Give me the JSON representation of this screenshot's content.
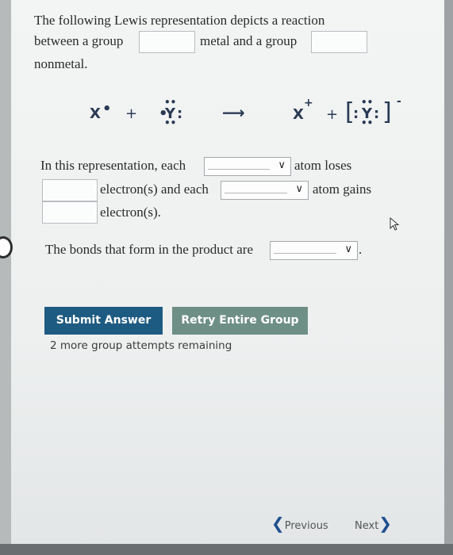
{
  "question": {
    "line1": "The following Lewis representation depicts a reaction",
    "line2_a": "between a group",
    "line2_b": "metal and a group",
    "line3": "nonmetal."
  },
  "equation": {
    "reactant1": "X",
    "plus1": "+",
    "reactant2": "Y",
    "arrow": "⟶",
    "product1": "X",
    "product1_charge": "+",
    "plus2": "+",
    "product2": "Y",
    "product2_charge": "-"
  },
  "representation": {
    "text_a": "In this representation, each",
    "text_b": "atom loses",
    "text_c": "electron(s) and each",
    "text_d": "atom gains",
    "text_e": "electron(s)."
  },
  "bonds": {
    "text": "The bonds that form in the product are",
    "period": "."
  },
  "buttons": {
    "submit": "Submit Answer",
    "retry": "Retry Entire Group"
  },
  "attempts": "2 more group attempts remaining",
  "nav": {
    "previous": "Previous",
    "next": "Next"
  },
  "colors": {
    "submit_bg": "#1e5b82",
    "retry_bg": "#6e8f86"
  }
}
